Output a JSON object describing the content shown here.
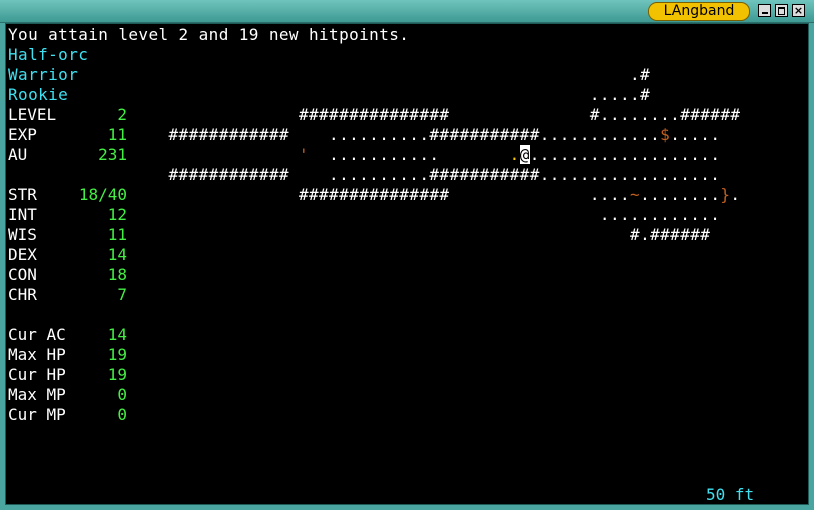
{
  "window": {
    "title": "LAngband"
  },
  "message": "You attain level 2 and 19 new hitpoints.",
  "character": {
    "race": "Half-orc",
    "class": "Warrior",
    "title": "Rookie"
  },
  "stats": [
    {
      "name": "LEVEL",
      "value": "2"
    },
    {
      "name": "EXP",
      "value": "11"
    },
    {
      "name": "AU",
      "value": "231"
    },
    {
      "name": "",
      "value": ""
    },
    {
      "name": "STR",
      "value": "18/40"
    },
    {
      "name": "INT",
      "value": "12"
    },
    {
      "name": "WIS",
      "value": "11"
    },
    {
      "name": "DEX",
      "value": "14"
    },
    {
      "name": "CON",
      "value": "18"
    },
    {
      "name": "CHR",
      "value": "7"
    },
    {
      "name": "",
      "value": ""
    },
    {
      "name": "Cur AC",
      "value": "14"
    },
    {
      "name": "Max HP",
      "value": "19"
    },
    {
      "name": "Cur HP",
      "value": "19"
    },
    {
      "name": "Max MP",
      "value": "0"
    },
    {
      "name": "Cur MP",
      "value": "0"
    }
  ],
  "map": {
    "rows": [
      [
        {
          "t": "                                                              .#",
          "c": "w"
        }
      ],
      [
        {
          "t": "                                                          .....#",
          "c": "w"
        }
      ],
      [
        {
          "t": "                             ###############              #........######",
          "c": "w"
        }
      ],
      [
        {
          "t": "                ############    ..........###########............",
          "c": "w"
        },
        {
          "t": "$",
          "c": "b"
        },
        {
          "t": ".....",
          "c": "w"
        }
      ],
      [
        {
          "t": "                             ",
          "c": "w"
        },
        {
          "t": "'",
          "c": "b"
        },
        {
          "t": "  ...........       ",
          "c": "w"
        },
        {
          "t": ".",
          "c": "y"
        },
        {
          "t": "@",
          "c": "at"
        },
        {
          "t": "...................",
          "c": "w"
        }
      ],
      [
        {
          "t": "                ############    ..........###########..................",
          "c": "w"
        }
      ],
      [
        {
          "t": "                             ###############              ....",
          "c": "w"
        },
        {
          "t": "~",
          "c": "b"
        },
        {
          "t": "........",
          "c": "w"
        },
        {
          "t": "}",
          "c": "b"
        },
        {
          "t": ".",
          "c": "w"
        }
      ],
      [
        {
          "t": "                                                           ............",
          "c": "w"
        }
      ],
      [
        {
          "t": "                                                              #.######",
          "c": "w"
        }
      ]
    ]
  },
  "status": {
    "depth": "50 ft"
  }
}
